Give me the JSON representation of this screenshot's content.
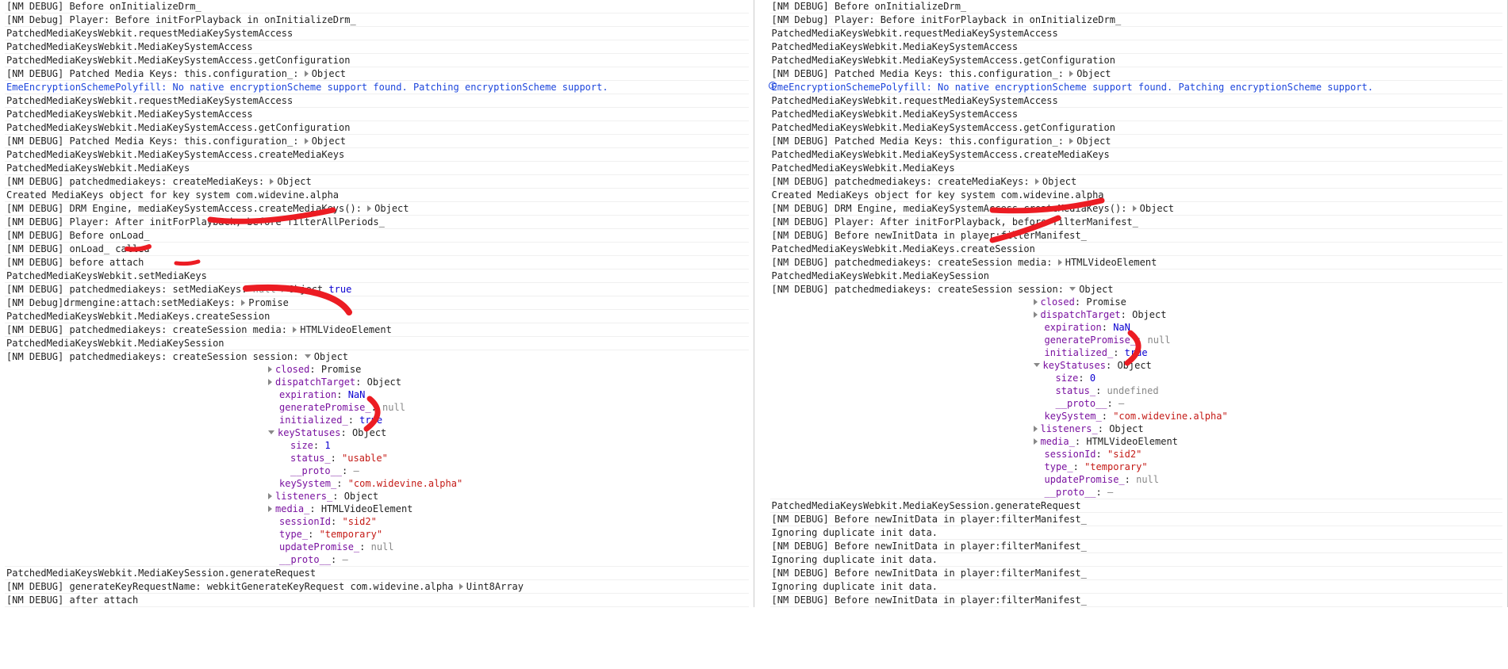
{
  "object_label": "Object",
  "promise_label": "Promise",
  "html_video_label": "HTMLVideoElement",
  "uint8_label": "Uint8Array",
  "true_label": "true",
  "null_label": "null",
  "nan_label": "NaN",
  "undefined_label": "undefined",
  "dash_label": "—",
  "left": {
    "lines": [
      "[NM DEBUG] Before onInitializeDrm_",
      "[NM Debug] Player: Before initForPlayback in onInitializeDrm_",
      "PatchedMediaKeysWebkit.requestMediaKeySystemAccess",
      "PatchedMediaKeysWebkit.MediaKeySystemAccess",
      "PatchedMediaKeysWebkit.MediaKeySystemAccess.getConfiguration"
    ],
    "pmk_config": {
      "prefix": "[NM DEBUG] Patched Media Keys: this.configuration_:  "
    },
    "info": "EmeEncryptionSchemePolyfill: No native encryptionScheme support found. Patching encryptionScheme support.",
    "lines2": [
      "PatchedMediaKeysWebkit.requestMediaKeySystemAccess",
      "PatchedMediaKeysWebkit.MediaKeySystemAccess",
      "PatchedMediaKeysWebkit.MediaKeySystemAccess.getConfiguration"
    ],
    "pmk_config2": {
      "prefix": "[NM DEBUG] Patched Media Keys: this.configuration_:  "
    },
    "lines3": [
      "PatchedMediaKeysWebkit.MediaKeySystemAccess.createMediaKeys",
      "PatchedMediaKeysWebkit.MediaKeys"
    ],
    "create_mk": {
      "prefix": "[NM DEBUG] patchedmediakeys: createMediaKeys:  "
    },
    "created": "Created MediaKeys object for key system com.widevine.alpha",
    "drm_engine": {
      "prefix": "[NM DEBUG] DRM Engine, mediaKeySystemAccess.createMediaKeys():  "
    },
    "after_init": "[NM DEBUG] Player: After initForPlayback, before filterAllPeriods_",
    "before_onload": "[NM DEBUG] Before onLoad_",
    "onload_called": "[NM DEBUG] onLoad_ called",
    "before_attach": "[NM DEBUG] before attach",
    "set_media_keys": "PatchedMediaKeysWebkit.setMediaKeys",
    "set_media_keys_row": {
      "prefix": "[NM DEBUG] patchedmediakeys: setMediaKeys:  "
    },
    "drm_attach": {
      "prefix": "[NM Debug]drmengine:attach:setMediaKeys:  "
    },
    "create_session": "PatchedMediaKeysWebkit.MediaKeys.createSession",
    "create_session_media": {
      "prefix": "[NM DEBUG] patchedmediakeys: createSession media:  "
    },
    "media_key_session": "PatchedMediaKeysWebkit.MediaKeySession",
    "session_row": {
      "prefix": "[NM DEBUG] patchedmediakeys: createSession session:  "
    },
    "object": {
      "closed_k": "closed",
      "dispatch_k": "dispatchTarget",
      "expiration_k": "expiration",
      "generatePromise_k": "generatePromise_",
      "initialized_k": "initialized_",
      "keyStatuses_k": "keyStatuses",
      "size_k": "size",
      "size_v": "1",
      "status_k": "status_",
      "status_v": "\"usable\"",
      "proto_k": "__proto__",
      "keySystem_k": "keySystem_",
      "keySystem_v": "\"com.widevine.alpha\"",
      "listeners_k": "listeners_",
      "media_k": "media_",
      "sessionId_k": "sessionId",
      "sessionId_v": "\"sid2\"",
      "type_k": "type_",
      "type_v": "\"temporary\"",
      "updatePromise_k": "updatePromise_"
    },
    "gen_request": "PatchedMediaKeysWebkit.MediaKeySession.generateRequest",
    "gen_key_req": {
      "prefix": "[NM DEBUG] generateKeyRequestName:  webkitGenerateKeyRequest com.widevine.alpha "
    },
    "after_attach": "[NM DEBUG] after attach"
  },
  "right": {
    "lines": [
      "[NM DEBUG] Before onInitializeDrm_",
      "[NM Debug] Player: Before initForPlayback in onInitializeDrm_",
      "PatchedMediaKeysWebkit.requestMediaKeySystemAccess",
      "PatchedMediaKeysWebkit.MediaKeySystemAccess",
      "PatchedMediaKeysWebkit.MediaKeySystemAccess.getConfiguration"
    ],
    "pmk_config": {
      "prefix": "[NM DEBUG] Patched Media Keys: this.configuration_:  "
    },
    "info": "EmeEncryptionSchemePolyfill: No native encryptionScheme support found. Patching encryptionScheme support.",
    "lines2": [
      "PatchedMediaKeysWebkit.requestMediaKeySystemAccess",
      "PatchedMediaKeysWebkit.MediaKeySystemAccess",
      "PatchedMediaKeysWebkit.MediaKeySystemAccess.getConfiguration"
    ],
    "pmk_config2": {
      "prefix": "[NM DEBUG] Patched Media Keys: this.configuration_:  "
    },
    "lines3": [
      "PatchedMediaKeysWebkit.MediaKeySystemAccess.createMediaKeys",
      "PatchedMediaKeysWebkit.MediaKeys"
    ],
    "create_mk": {
      "prefix": "[NM DEBUG] patchedmediakeys: createMediaKeys:  "
    },
    "created": "Created MediaKeys object for key system com.widevine.alpha",
    "drm_engine": {
      "prefix": "[NM DEBUG] DRM Engine, mediaKeySystemAccess.createMediaKeys():  "
    },
    "after_init": "[NM DEBUG] Player: After initForPlayback, before filterManifest_",
    "before_new_init": "[NM DEBUG] Before newInitData in player:filterManifest_",
    "create_session": "PatchedMediaKeysWebkit.MediaKeys.createSession",
    "create_session_media": {
      "prefix": "[NM DEBUG] patchedmediakeys: createSession media:  "
    },
    "media_key_session": "PatchedMediaKeysWebkit.MediaKeySession",
    "session_row": {
      "prefix": "[NM DEBUG] patchedmediakeys: createSession session:  "
    },
    "object": {
      "closed_k": "closed",
      "dispatch_k": "dispatchTarget",
      "expiration_k": "expiration",
      "generatePromise_k": "generatePromise_",
      "initialized_k": "initialized_",
      "keyStatuses_k": "keyStatuses",
      "size_k": "size",
      "size_v": "0",
      "status_k": "status_",
      "proto_k": "__proto__",
      "keySystem_k": "keySystem_",
      "keySystem_v": "\"com.widevine.alpha\"",
      "listeners_k": "listeners_",
      "media_k": "media_",
      "sessionId_k": "sessionId",
      "sessionId_v": "\"sid2\"",
      "type_k": "type_",
      "type_v": "\"temporary\"",
      "updatePromise_k": "updatePromise_"
    },
    "tail": [
      "PatchedMediaKeysWebkit.MediaKeySession.generateRequest",
      "[NM DEBUG] Before newInitData in player:filterManifest_",
      "Ignoring duplicate init data.",
      "[NM DEBUG] Before newInitData in player:filterManifest_",
      "Ignoring duplicate init data.",
      "[NM DEBUG] Before newInitData in player:filterManifest_",
      "Ignoring duplicate init data.",
      "[NM DEBUG] Before newInitData in player:filterManifest_"
    ]
  }
}
